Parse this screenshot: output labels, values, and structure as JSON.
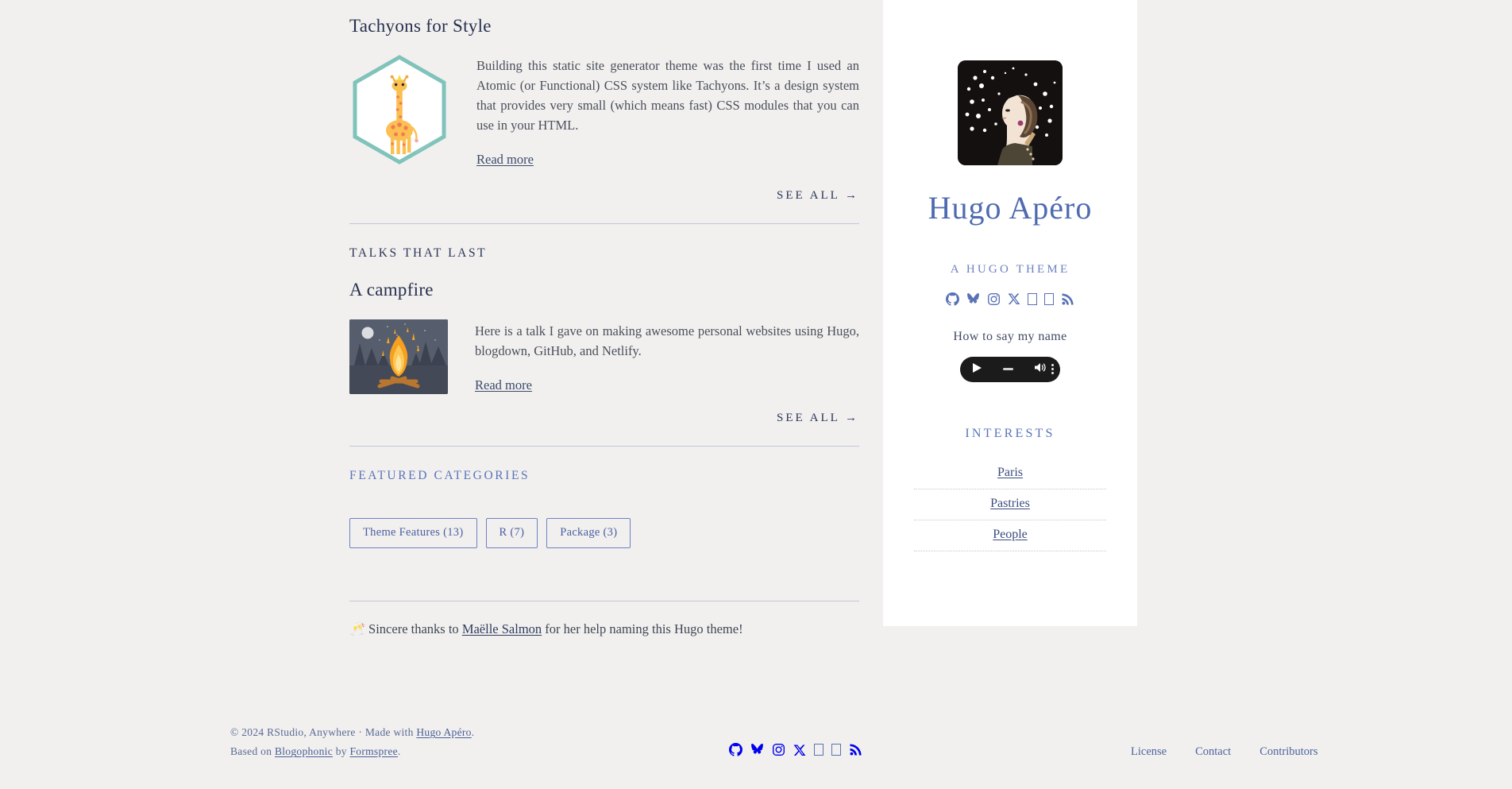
{
  "sidebar": {
    "avatar_alt": "art-deco-woman-portrait",
    "title": "Hugo Apéro",
    "subtitle": "A HUGO THEME",
    "social": [
      {
        "name": "github-icon",
        "label": "GitHub"
      },
      {
        "name": "bluesky-icon",
        "label": "Bluesky"
      },
      {
        "name": "instagram-icon",
        "label": "Instagram"
      },
      {
        "name": "x-twitter-icon",
        "label": "X"
      },
      {
        "name": "missing-glyph-icon",
        "label": ""
      },
      {
        "name": "missing-glyph-icon",
        "label": ""
      },
      {
        "name": "rss-icon",
        "label": "RSS"
      }
    ],
    "audio_label": "How to say my name",
    "audio_controls": {
      "play": "play-button",
      "progress": "progress-bar",
      "volume": "volume-button",
      "menu": "more-options-button"
    },
    "interests_heading": "INTERESTS",
    "interests": [
      "Paris",
      "Pastries",
      "People"
    ]
  },
  "main": {
    "blog_post": {
      "title": "Tachyons for Style",
      "thumb": "giraffe-hexagon-logo",
      "summary": "Building this static site generator theme was the first time I used an Atomic (or Functional) CSS system like Tachyons. It’s a design system that provides very small (which means fast) CSS modules that you can use in your HTML.",
      "read_more": "Read more"
    },
    "blog_see_all": "SEE ALL  →",
    "talks_heading": "TALKS THAT LAST",
    "talk": {
      "title": "A campfire",
      "thumb": "campfire-illustration",
      "summary": "Here is a talk I gave on making awesome personal websites using Hugo, blogdown, GitHub, and Netlify.",
      "read_more": "Read more"
    },
    "talks_see_all": "SEE ALL  →",
    "categories_heading": "FEATURED CATEGORIES",
    "categories": [
      {
        "label": "Theme Features (13)"
      },
      {
        "label": "R (7)"
      },
      {
        "label": "Package (3)"
      }
    ],
    "thanks": {
      "emoji": "🥂",
      "before": " Sincere thanks to ",
      "link": "Maëlle Salmon",
      "after": " for her help naming this Hugo theme!"
    }
  },
  "footer": {
    "copyright_prefix": "© 2024 RStudio, Anywhere  ·  Made with ",
    "made_with_link": "Hugo Apéro",
    "copyright_suffix": ".",
    "based_prefix": "Based on ",
    "based_link": "Blogophonic",
    "based_mid": " by ",
    "based_link2": "Formspree",
    "based_suffix": ".",
    "social": [
      {
        "name": "github-icon"
      },
      {
        "name": "bluesky-icon"
      },
      {
        "name": "instagram-icon"
      },
      {
        "name": "x-twitter-icon"
      },
      {
        "name": "missing-glyph-icon"
      },
      {
        "name": "missing-glyph-icon"
      },
      {
        "name": "rss-icon"
      }
    ],
    "links": [
      "License",
      "Contact",
      "Contributors"
    ]
  },
  "colors": {
    "page_bg": "#f1f0ee",
    "panel_bg": "#ffffff",
    "accent_blue": "#4f6bb0",
    "text_dark": "#27304f",
    "hex_teal": "#7fc3bb"
  }
}
